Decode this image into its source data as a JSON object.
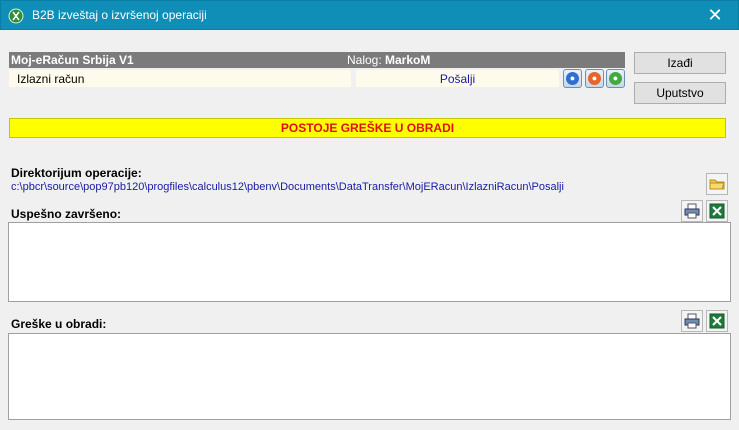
{
  "window": {
    "title": "B2B izveštaj o izvršenoj operaciji",
    "close_glyph": "✕"
  },
  "header": {
    "app_name": "Moj-eRačun Srbija V1",
    "nalog_label": "Nalog:",
    "nalog_value": "MarkoM",
    "document_type": "Izlazni račun",
    "action": "Pošalji"
  },
  "buttons": {
    "exit": "Izađi",
    "instructions": "Uputstvo"
  },
  "status_banner": "POSTOJE GREŠKE U OBRADI",
  "directory": {
    "label": "Direktorijum operacije:",
    "path": "c:\\pbcr\\source\\pop97pb120\\progfiles\\calculus12\\pbenv\\Documents\\DataTransfer\\MojERacun\\IzlazniRacun\\Posalji"
  },
  "success_section": {
    "label": "Uspešno završeno:",
    "content": ""
  },
  "errors_section": {
    "label": "Greške u obradi:",
    "content": ""
  },
  "colors": {
    "titlebar": "#0f8eb8",
    "banner_bg": "#ffff00",
    "banner_text": "#e11010",
    "link_text": "#1a1aa6"
  },
  "icons": [
    "app-logo-icon",
    "close-icon",
    "blue-globe-icon",
    "orange-globe-icon",
    "green-globe-icon",
    "folder-icon",
    "printer-icon",
    "excel-icon"
  ]
}
